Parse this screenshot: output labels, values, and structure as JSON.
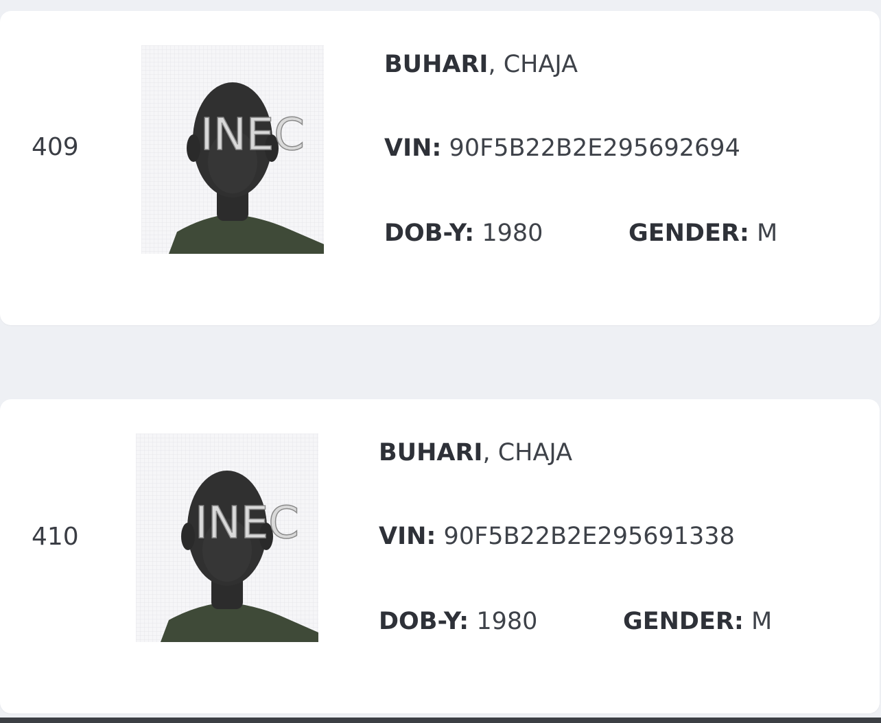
{
  "records": [
    {
      "serial": "409",
      "surname": "BUHARI",
      "separator": ", ",
      "given_name": "CHAJA",
      "vin_label": "VIN:",
      "vin": "90F5B22B2E295692694",
      "dob_label": "DOB-Y:",
      "dob": "1980",
      "gender_label": "GENDER:",
      "gender": "M",
      "photo_watermark": "INEC"
    },
    {
      "serial": "410",
      "surname": "BUHARI",
      "separator": ", ",
      "given_name": "CHAJA",
      "vin_label": "VIN:",
      "vin": "90F5B22B2E295691338",
      "dob_label": "DOB-Y:",
      "dob": "1980",
      "gender_label": "GENDER:",
      "gender": "M",
      "photo_watermark": "INEC"
    }
  ],
  "colors": {
    "page_background": "#eef0f4",
    "card_background": "#ffffff",
    "text": "#2e3138"
  }
}
